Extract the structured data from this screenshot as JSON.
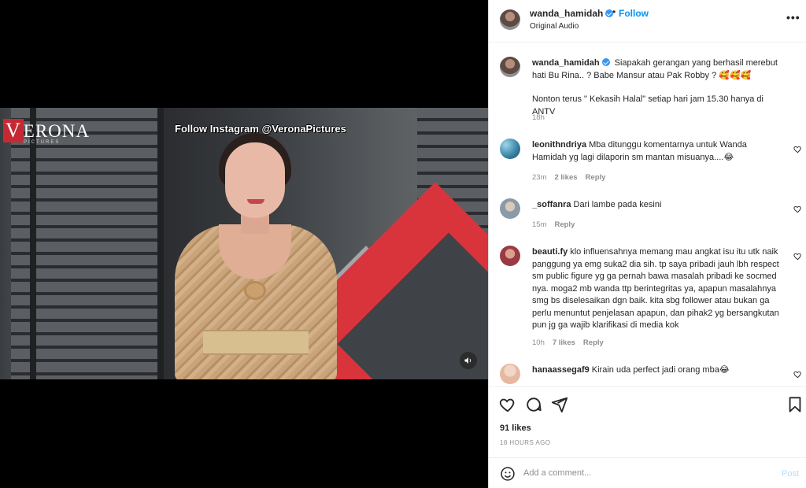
{
  "media": {
    "logo_text": "ERONA",
    "logo_letter": "V",
    "logo_sub": "PICTURES",
    "overlay_caption": "Follow Instagram @VeronaPictures",
    "audio_icon": "speaker-icon"
  },
  "header": {
    "username": "wanda_hamidah",
    "separator": "•",
    "follow_label": "Follow",
    "audio_label": "Original Audio",
    "more_label": "•••"
  },
  "caption": {
    "username": "wanda_hamidah",
    "text_line1": "Siapakah gerangan yang berhasil merebut hati Bu Rina.. ? Babe Mansur atau Pak Robby ? 🥰🥰🥰",
    "text_line2": "Nonton terus \" Kekasih Halal\" setiap hari jam 15.30 hanya di ANTV",
    "time": "18h"
  },
  "comments": [
    {
      "username": "leonithndriya",
      "text": "Mba ditunggu komentarnya untuk Wanda Hamidah yg lagi dilaporin sm mantan misuanya....😂",
      "time": "23m",
      "likes": "2 likes",
      "reply": "Reply"
    },
    {
      "username": "_soffanra",
      "text": "Dari lambe pada kesini",
      "time": "15m",
      "reply": "Reply"
    },
    {
      "username": "beauti.fy",
      "text": "klo influensahnya memang mau angkat isu itu utk naik panggung ya emg suka2 dia sih. tp saya pribadi jauh lbh respect sm public figure yg ga pernah bawa masalah pribadi ke socmed nya. moga2 mb wanda ttp berintegritas ya, apapun masalahnya smg bs diselesaikan dgn baik. kita sbg follower atau bukan ga perlu menuntut penjelasan apapun, dan pihak2 yg bersangkutan pun jg ga wajib klarifikasi di media kok",
      "time": "10h",
      "likes": "7 likes",
      "reply": "Reply"
    },
    {
      "username": "hanaassegaf9",
      "text": "Kirain uda perfect jadi orang mba😂"
    }
  ],
  "actions": {
    "likes": "91 likes",
    "timestamp": "18 HOURS AGO"
  },
  "composer": {
    "placeholder": "Add a comment...",
    "post_label": "Post"
  },
  "colors": {
    "accent": "#0095f6",
    "verified": "#3897f0",
    "muted": "#8e8e8e",
    "post_disabled": "#b2dffc"
  }
}
